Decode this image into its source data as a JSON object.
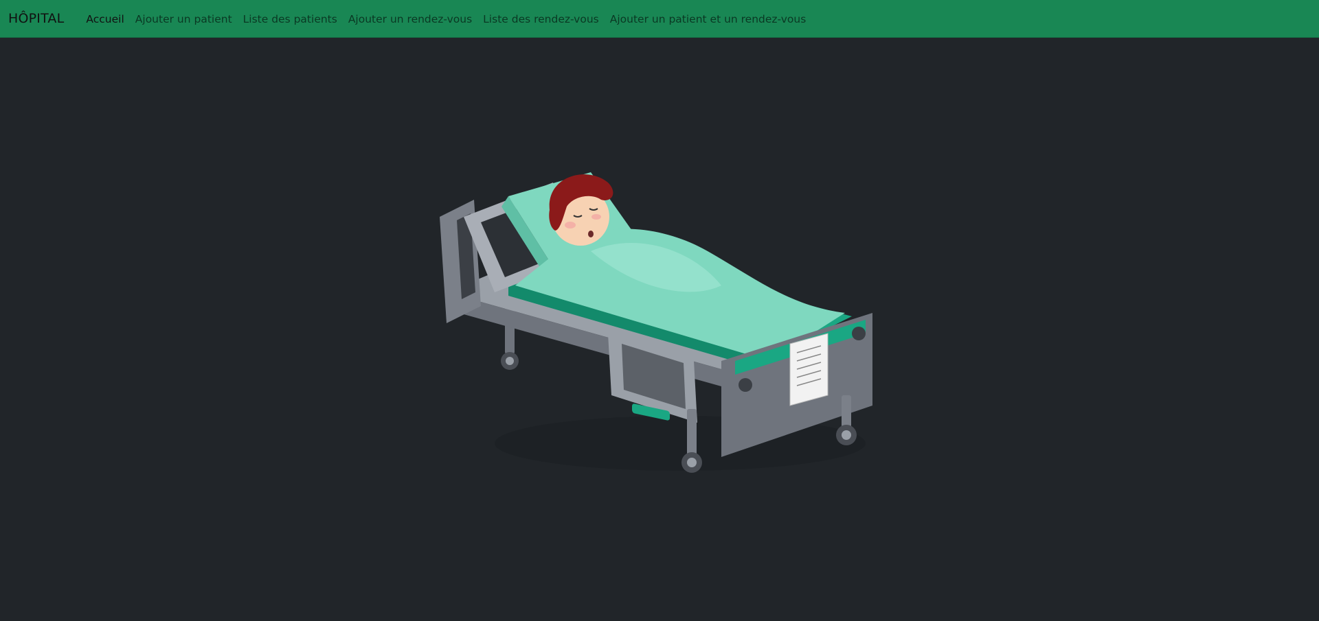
{
  "navbar": {
    "brand": "HÔPITAL",
    "links": [
      {
        "label": "Accueil",
        "active": true
      },
      {
        "label": "Ajouter un patient",
        "active": false
      },
      {
        "label": "Liste des patients",
        "active": false
      },
      {
        "label": "Ajouter un rendez-vous",
        "active": false
      },
      {
        "label": "Liste des rendez-vous",
        "active": false
      },
      {
        "label": "Ajouter un patient et un rendez-vous",
        "active": false
      }
    ]
  },
  "main": {
    "illustration_icon": "hospital-bed-patient-illustration"
  },
  "colors": {
    "navbar_bg": "#198754",
    "page_bg": "#212529",
    "sheet": "#7fd8bf",
    "mattress": "#1aa783",
    "bed_frame": "#8a8f99",
    "hair": "#8b1a1a"
  }
}
